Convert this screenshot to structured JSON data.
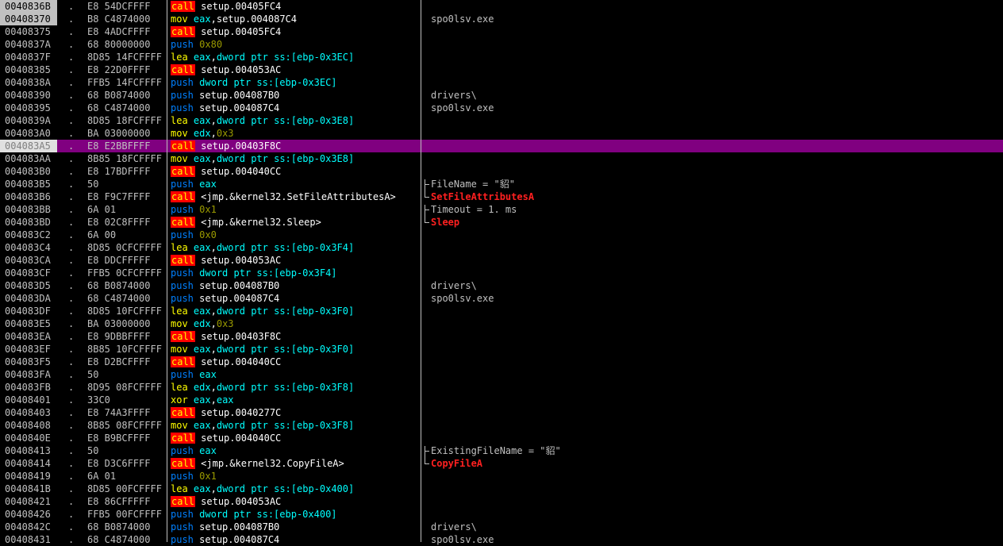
{
  "window": {
    "background": "#000000",
    "selected_row_color": "#800080"
  },
  "rows": [
    {
      "addr": "0040836B",
      "dot": ".",
      "hex": "E8 54DCFFFF",
      "mn": "call",
      "op": "setup.00405FC4",
      "cmt": "",
      "cmt_type": "",
      "first": true
    },
    {
      "addr": "00408370",
      "dot": ".",
      "hex": "B8 C4874000",
      "mn": "mov",
      "op": "eax,setup.004087C4",
      "cmt": "spo0lsv.exe",
      "cmt_type": "normal",
      "first": true
    },
    {
      "addr": "00408375",
      "dot": ".",
      "hex": "E8 4ADCFFFF",
      "mn": "call",
      "op": "setup.00405FC4",
      "cmt": "",
      "cmt_type": ""
    },
    {
      "addr": "0040837A",
      "dot": ".",
      "hex": "68 80000000",
      "mn": "push",
      "op": "0x80",
      "cmt": "",
      "cmt_type": ""
    },
    {
      "addr": "0040837F",
      "dot": ".",
      "hex": "8D85 14FCFFFF",
      "mn": "lea",
      "op": "eax,dword ptr ss:[ebp-0x3EC]",
      "cmt": "",
      "cmt_type": ""
    },
    {
      "addr": "00408385",
      "dot": ".",
      "hex": "E8 22D0FFFF",
      "mn": "call",
      "op": "setup.004053AC",
      "cmt": "",
      "cmt_type": ""
    },
    {
      "addr": "0040838A",
      "dot": ".",
      "hex": "FFB5 14FCFFFF",
      "mn": "push",
      "op": "dword ptr ss:[ebp-0x3EC]",
      "cmt": "",
      "cmt_type": ""
    },
    {
      "addr": "00408390",
      "dot": ".",
      "hex": "68 B0874000",
      "mn": "push",
      "op": "setup.004087B0",
      "cmt": "drivers\\",
      "cmt_type": "normal"
    },
    {
      "addr": "00408395",
      "dot": ".",
      "hex": "68 C4874000",
      "mn": "push",
      "op": "setup.004087C4",
      "cmt": "spo0lsv.exe",
      "cmt_type": "normal"
    },
    {
      "addr": "0040839A",
      "dot": ".",
      "hex": "8D85 18FCFFFF",
      "mn": "lea",
      "op": "eax,dword ptr ss:[ebp-0x3E8]",
      "cmt": "",
      "cmt_type": ""
    },
    {
      "addr": "004083A0",
      "dot": ".",
      "hex": "BA 03000000",
      "mn": "mov",
      "op": "edx,0x3",
      "cmt": "",
      "cmt_type": ""
    },
    {
      "addr": "004083A5",
      "dot": ".",
      "hex": "E8 E2BBFFFF",
      "mn": "call",
      "op": "setup.00403F8C",
      "cmt": "",
      "cmt_type": "",
      "selected": true
    },
    {
      "addr": "004083AA",
      "dot": ".",
      "hex": "8B85 18FCFFFF",
      "mn": "mov",
      "op": "eax,dword ptr ss:[ebp-0x3E8]",
      "cmt": "",
      "cmt_type": ""
    },
    {
      "addr": "004083B0",
      "dot": ".",
      "hex": "E8 17BDFFFF",
      "mn": "call",
      "op": "setup.004040CC",
      "cmt": "",
      "cmt_type": ""
    },
    {
      "addr": "004083B5",
      "dot": ".",
      "hex": "50",
      "mn": "push",
      "op": "eax",
      "cmt": "FileName = \"貂\"",
      "cmt_type": "normal",
      "br": "top"
    },
    {
      "addr": "004083B6",
      "dot": ".",
      "hex": "E8 F9C7FFFF",
      "mn": "call",
      "op": "<jmp.&kernel32.SetFileAttributesA>",
      "cmt": "SetFileAttributesA",
      "cmt_type": "api",
      "br": "end"
    },
    {
      "addr": "004083BB",
      "dot": ".",
      "hex": "6A 01",
      "mn": "push",
      "op": "0x1",
      "cmt": "Timeout = 1. ms",
      "cmt_type": "normal",
      "br": "top"
    },
    {
      "addr": "004083BD",
      "dot": ".",
      "hex": "E8 02C8FFFF",
      "mn": "call",
      "op": "<jmp.&kernel32.Sleep>",
      "cmt": "Sleep",
      "cmt_type": "api",
      "br": "end"
    },
    {
      "addr": "004083C2",
      "dot": ".",
      "hex": "6A 00",
      "mn": "push",
      "op": "0x0",
      "cmt": "",
      "cmt_type": ""
    },
    {
      "addr": "004083C4",
      "dot": ".",
      "hex": "8D85 0CFCFFFF",
      "mn": "lea",
      "op": "eax,dword ptr ss:[ebp-0x3F4]",
      "cmt": "",
      "cmt_type": ""
    },
    {
      "addr": "004083CA",
      "dot": ".",
      "hex": "E8 DDCFFFFF",
      "mn": "call",
      "op": "setup.004053AC",
      "cmt": "",
      "cmt_type": ""
    },
    {
      "addr": "004083CF",
      "dot": ".",
      "hex": "FFB5 0CFCFFFF",
      "mn": "push",
      "op": "dword ptr ss:[ebp-0x3F4]",
      "cmt": "",
      "cmt_type": ""
    },
    {
      "addr": "004083D5",
      "dot": ".",
      "hex": "68 B0874000",
      "mn": "push",
      "op": "setup.004087B0",
      "cmt": "drivers\\",
      "cmt_type": "normal"
    },
    {
      "addr": "004083DA",
      "dot": ".",
      "hex": "68 C4874000",
      "mn": "push",
      "op": "setup.004087C4",
      "cmt": "spo0lsv.exe",
      "cmt_type": "normal"
    },
    {
      "addr": "004083DF",
      "dot": ".",
      "hex": "8D85 10FCFFFF",
      "mn": "lea",
      "op": "eax,dword ptr ss:[ebp-0x3F0]",
      "cmt": "",
      "cmt_type": ""
    },
    {
      "addr": "004083E5",
      "dot": ".",
      "hex": "BA 03000000",
      "mn": "mov",
      "op": "edx,0x3",
      "cmt": "",
      "cmt_type": ""
    },
    {
      "addr": "004083EA",
      "dot": ".",
      "hex": "E8 9DBBFFFF",
      "mn": "call",
      "op": "setup.00403F8C",
      "cmt": "",
      "cmt_type": ""
    },
    {
      "addr": "004083EF",
      "dot": ".",
      "hex": "8B85 10FCFFFF",
      "mn": "mov",
      "op": "eax,dword ptr ss:[ebp-0x3F0]",
      "cmt": "",
      "cmt_type": ""
    },
    {
      "addr": "004083F5",
      "dot": ".",
      "hex": "E8 D2BCFFFF",
      "mn": "call",
      "op": "setup.004040CC",
      "cmt": "",
      "cmt_type": ""
    },
    {
      "addr": "004083FA",
      "dot": ".",
      "hex": "50",
      "mn": "push",
      "op": "eax",
      "cmt": "",
      "cmt_type": ""
    },
    {
      "addr": "004083FB",
      "dot": ".",
      "hex": "8D95 08FCFFFF",
      "mn": "lea",
      "op": "edx,dword ptr ss:[ebp-0x3F8]",
      "cmt": "",
      "cmt_type": ""
    },
    {
      "addr": "00408401",
      "dot": ".",
      "hex": "33C0",
      "mn": "xor",
      "op": "eax,eax",
      "cmt": "",
      "cmt_type": ""
    },
    {
      "addr": "00408403",
      "dot": ".",
      "hex": "E8 74A3FFFF",
      "mn": "call",
      "op": "setup.0040277C",
      "cmt": "",
      "cmt_type": ""
    },
    {
      "addr": "00408408",
      "dot": ".",
      "hex": "8B85 08FCFFFF",
      "mn": "mov",
      "op": "eax,dword ptr ss:[ebp-0x3F8]",
      "cmt": "",
      "cmt_type": ""
    },
    {
      "addr": "0040840E",
      "dot": ".",
      "hex": "E8 B9BCFFFF",
      "mn": "call",
      "op": "setup.004040CC",
      "cmt": "",
      "cmt_type": ""
    },
    {
      "addr": "00408413",
      "dot": ".",
      "hex": "50",
      "mn": "push",
      "op": "eax",
      "cmt": "ExistingFileName = \"貂\"",
      "cmt_type": "normal",
      "br": "top"
    },
    {
      "addr": "00408414",
      "dot": ".",
      "hex": "E8 D3C6FFFF",
      "mn": "call",
      "op": "<jmp.&kernel32.CopyFileA>",
      "cmt": "CopyFileA",
      "cmt_type": "api",
      "br": "end"
    },
    {
      "addr": "00408419",
      "dot": ".",
      "hex": "6A 01",
      "mn": "push",
      "op": "0x1",
      "cmt": "",
      "cmt_type": ""
    },
    {
      "addr": "0040841B",
      "dot": ".",
      "hex": "8D85 00FCFFFF",
      "mn": "lea",
      "op": "eax,dword ptr ss:[ebp-0x400]",
      "cmt": "",
      "cmt_type": ""
    },
    {
      "addr": "00408421",
      "dot": ".",
      "hex": "E8 86CFFFFF",
      "mn": "call",
      "op": "setup.004053AC",
      "cmt": "",
      "cmt_type": ""
    },
    {
      "addr": "00408426",
      "dot": ".",
      "hex": "FFB5 00FCFFFF",
      "mn": "push",
      "op": "dword ptr ss:[ebp-0x400]",
      "cmt": "",
      "cmt_type": ""
    },
    {
      "addr": "0040842C",
      "dot": ".",
      "hex": "68 B0874000",
      "mn": "push",
      "op": "setup.004087B0",
      "cmt": "drivers\\",
      "cmt_type": "normal"
    },
    {
      "addr": "00408431",
      "dot": ".",
      "hex": "68 C4874000",
      "mn": "push",
      "op": "setup.004087C4",
      "cmt": "spo0lsv.exe",
      "cmt_type": "normal"
    }
  ]
}
